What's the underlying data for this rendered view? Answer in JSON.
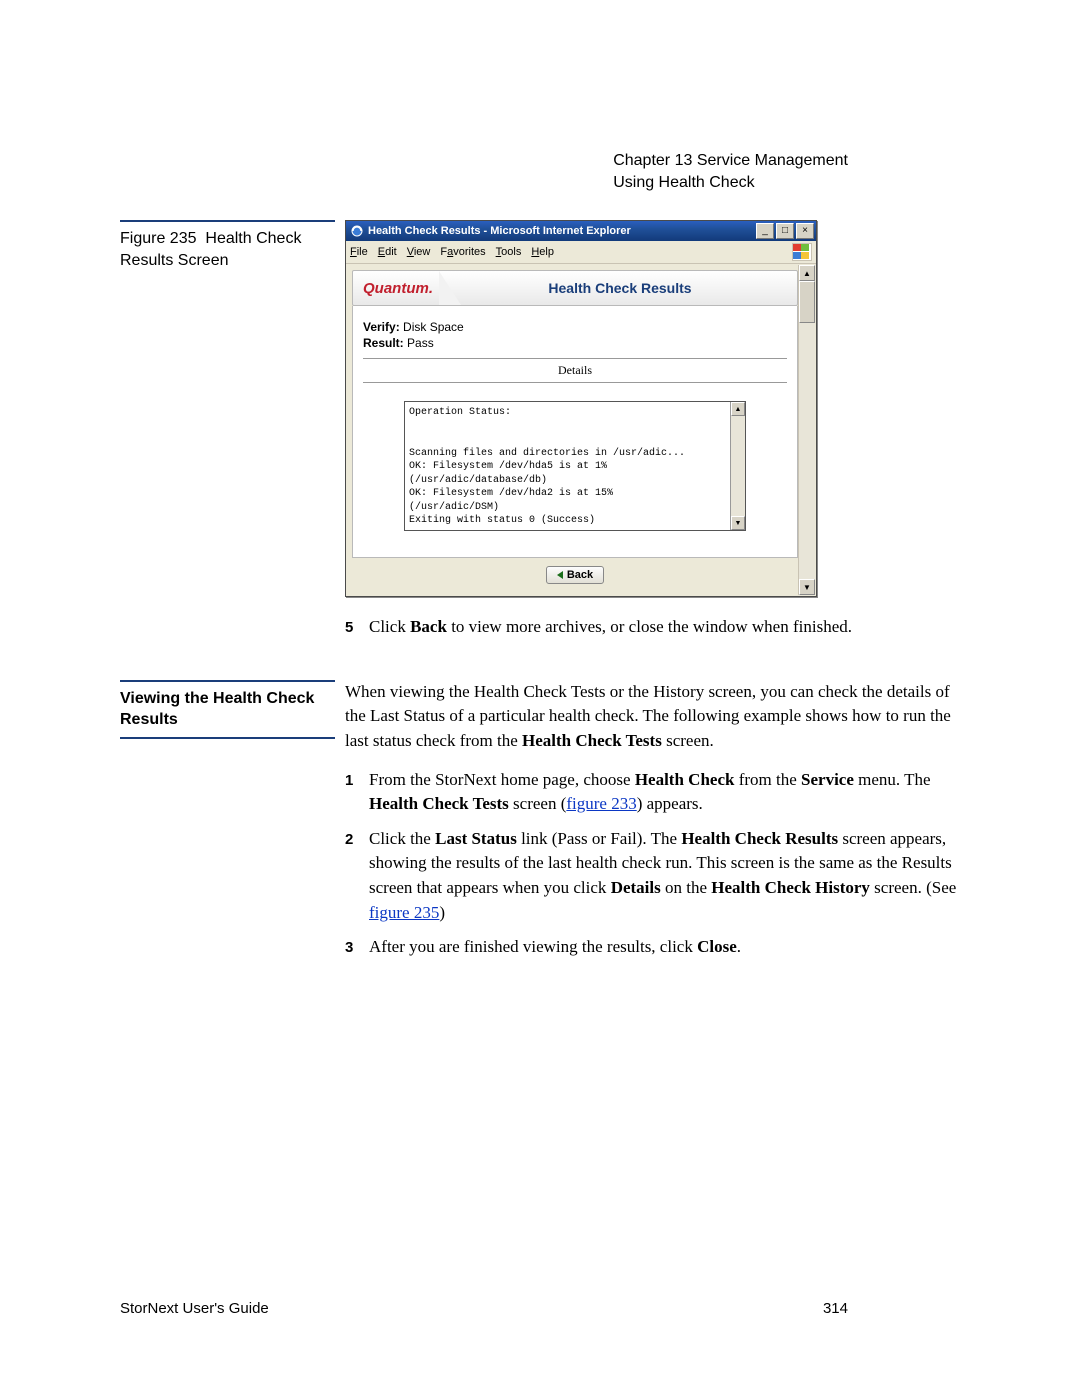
{
  "header": {
    "chapter": "Chapter 13  Service Management",
    "section": "Using Health Check"
  },
  "figure": {
    "caption_prefix": "Figure 235",
    "caption_title": "Health Check Results Screen"
  },
  "window": {
    "title": "Health Check Results - Microsoft Internet Explorer",
    "menu": [
      "File",
      "Edit",
      "View",
      "Favorites",
      "Tools",
      "Help"
    ],
    "brand": "Quantum.",
    "banner_title": "Health Check Results",
    "verify_label": "Verify:",
    "verify_value": "Disk Space",
    "result_label": "Result:",
    "result_value": "Pass",
    "details_label": "Details",
    "output": "Operation Status:\n\n\nScanning files and directories in /usr/adic...\nOK: Filesystem /dev/hda5 is at 1%\n(/usr/adic/database/db)\nOK: Filesystem /dev/hda2 is at 15%\n(/usr/adic/DSM)\nExiting with status 0 (Success)",
    "back_label": "Back"
  },
  "step5": {
    "num": "5",
    "pre": "Click ",
    "bold": "Back",
    "post": " to view more archives, or close the window when finished."
  },
  "section2": {
    "heading": "Viewing the Health Check Results",
    "intro_1": "When viewing the Health Check Tests or the History screen, you can check the details of the Last Status of a particular health check. The following example shows how to run the last status check from the ",
    "intro_bold": "Health Check Tests",
    "intro_2": " screen.",
    "steps": [
      {
        "num": "1",
        "parts": [
          {
            "t": "From the StorNext home page, choose "
          },
          {
            "b": "Health Check"
          },
          {
            "t": " from the "
          },
          {
            "b": "Service"
          },
          {
            "t": " menu. The "
          },
          {
            "b": "Health Check Tests"
          },
          {
            "t": " screen ("
          },
          {
            "link": "figure 233"
          },
          {
            "t": ") appears."
          }
        ]
      },
      {
        "num": "2",
        "parts": [
          {
            "t": "Click the "
          },
          {
            "b": "Last Status"
          },
          {
            "t": " link (Pass or Fail). The "
          },
          {
            "b": "Health Check Results"
          },
          {
            "t": " screen appears, showing the results of the last health check run. This screen is the same as the Results screen that appears when you click "
          },
          {
            "b": "Details"
          },
          {
            "t": " on the "
          },
          {
            "b": "Health Check History"
          },
          {
            "t": " screen. (See "
          },
          {
            "link": "figure 235"
          },
          {
            "t": ")"
          }
        ]
      },
      {
        "num": "3",
        "parts": [
          {
            "t": "After you are finished viewing the results, click "
          },
          {
            "b": "Close"
          },
          {
            "t": "."
          }
        ]
      }
    ]
  },
  "footer": {
    "left": "StorNext User's Guide",
    "right": "314"
  }
}
